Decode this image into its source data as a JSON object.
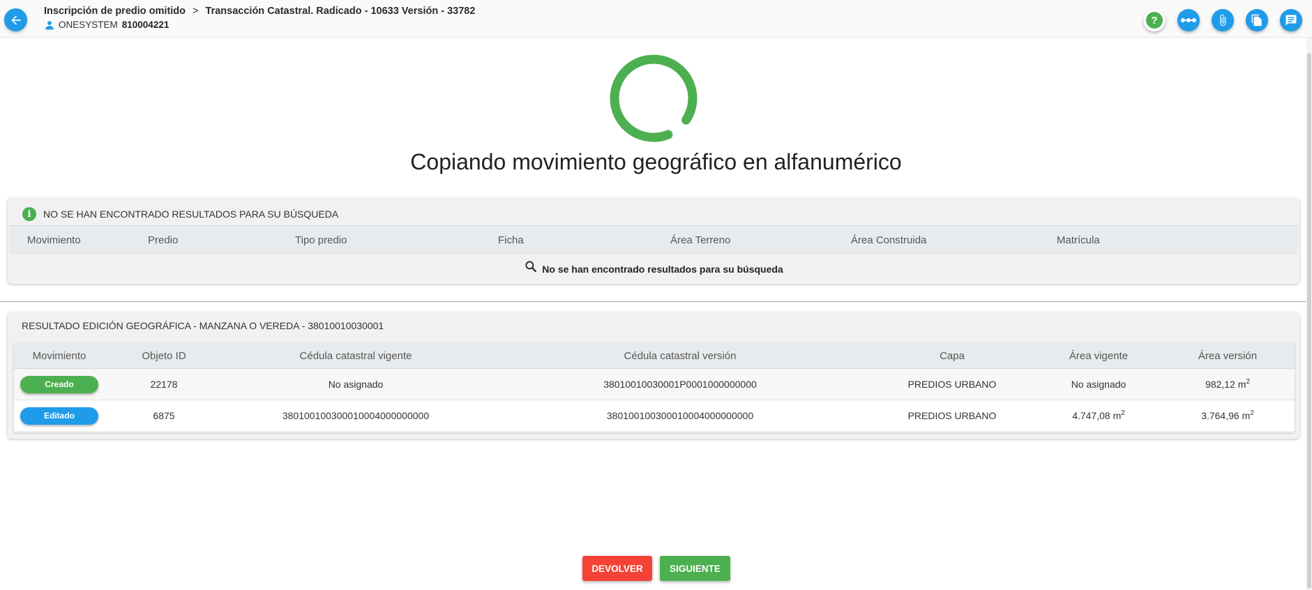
{
  "header": {
    "breadcrumb_item_1": "Inscripción de predio omitido",
    "breadcrumb_separator": ">",
    "breadcrumb_item_2": "Transacción Catastral. Radicado - 10633 Versión - 33782",
    "user_name": "ONESYSTEM",
    "user_id": "810004221",
    "actions": [
      "help-icon",
      "flow-icon",
      "attachment-icon",
      "documents-icon",
      "notes-icon"
    ],
    "help_label": "?"
  },
  "status": {
    "message": "Copiando movimiento geográfico en alfanumérico",
    "spinner_color": "#4caf50"
  },
  "search_panel": {
    "info_label": "i",
    "notice": "NO SE HAN ENCONTRADO RESULTADOS PARA SU BÚSQUEDA",
    "columns": [
      "Movimiento",
      "Predio",
      "Tipo predio",
      "Ficha",
      "Área Terreno",
      "Área Construida",
      "Matrícula"
    ],
    "empty_message": "No se han encontrado resultados para su búsqueda"
  },
  "geo_panel": {
    "title": "RESULTADO EDICIÓN GEOGRÁFICA - MANZANA O VEREDA - 38010010030001",
    "columns": [
      "Movimiento",
      "Objeto ID",
      "Cédula catastral vigente",
      "Cédula catastral versión",
      "Capa",
      "Área vigente",
      "Área versión"
    ],
    "rows": [
      {
        "movimiento": "Creado",
        "movimiento_color": "#4caf50",
        "objeto_id": "22178",
        "cedula_vigente": "No asignado",
        "cedula_version": "38010010030001P0001000000000",
        "capa": "PREDIOS URBANO",
        "area_vigente": "No asignado",
        "area_vigente_unit": "",
        "area_vigente_exp": "",
        "area_version": "982,12 m",
        "area_version_exp": "2"
      },
      {
        "movimiento": "Editado",
        "movimiento_color": "#1e9be9",
        "objeto_id": "6875",
        "cedula_vigente": "380100100300010004000000000",
        "cedula_version": "380100100300010004000000000",
        "capa": "PREDIOS URBANO",
        "area_vigente": "4.747,08 m",
        "area_vigente_exp": "2",
        "area_version": "3.764,96 m",
        "area_version_exp": "2"
      }
    ]
  },
  "footer": {
    "return_label": "DEVOLVER",
    "return_color": "#f44336",
    "next_label": "SIGUIENTE",
    "next_color": "#4caf50"
  }
}
